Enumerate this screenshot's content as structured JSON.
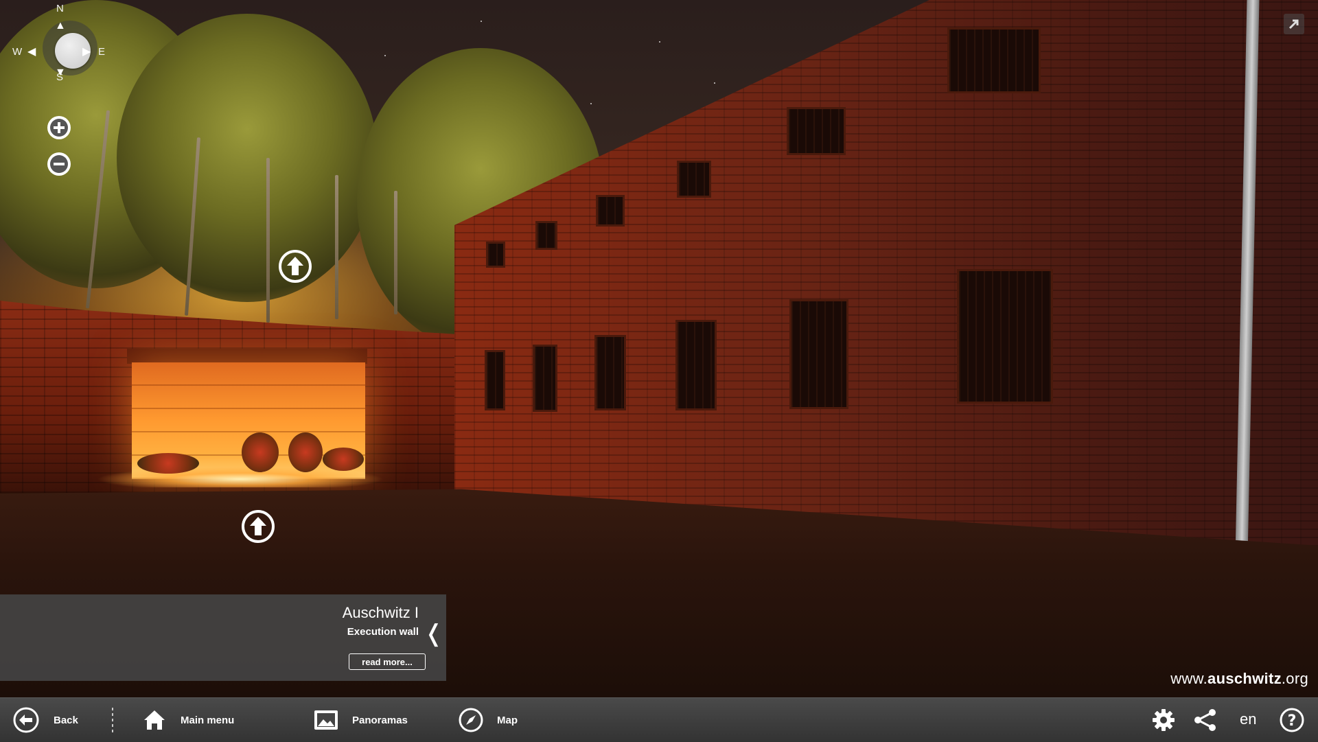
{
  "compass": {
    "north": "N",
    "south": "S",
    "east": "E",
    "west": "W"
  },
  "info_panel": {
    "title": "Auschwitz I",
    "subtitle": "Execution wall",
    "read_more": "read more...",
    "collapse_glyph": "❬"
  },
  "watermark": {
    "prefix": "www.",
    "brand": "auschwitz",
    "suffix": ".org"
  },
  "bottom_bar": {
    "back": "Back",
    "main_menu": "Main menu",
    "panoramas": "Panoramas",
    "map": "Map",
    "language": "en"
  },
  "icons": [
    "compass-knob",
    "zoom-in-icon",
    "zoom-out-icon",
    "hotspot-arrow-icon",
    "expand-icon",
    "back-icon",
    "home-icon",
    "panoramas-icon",
    "map-compass-icon",
    "settings-icon",
    "share-icon",
    "help-icon"
  ]
}
